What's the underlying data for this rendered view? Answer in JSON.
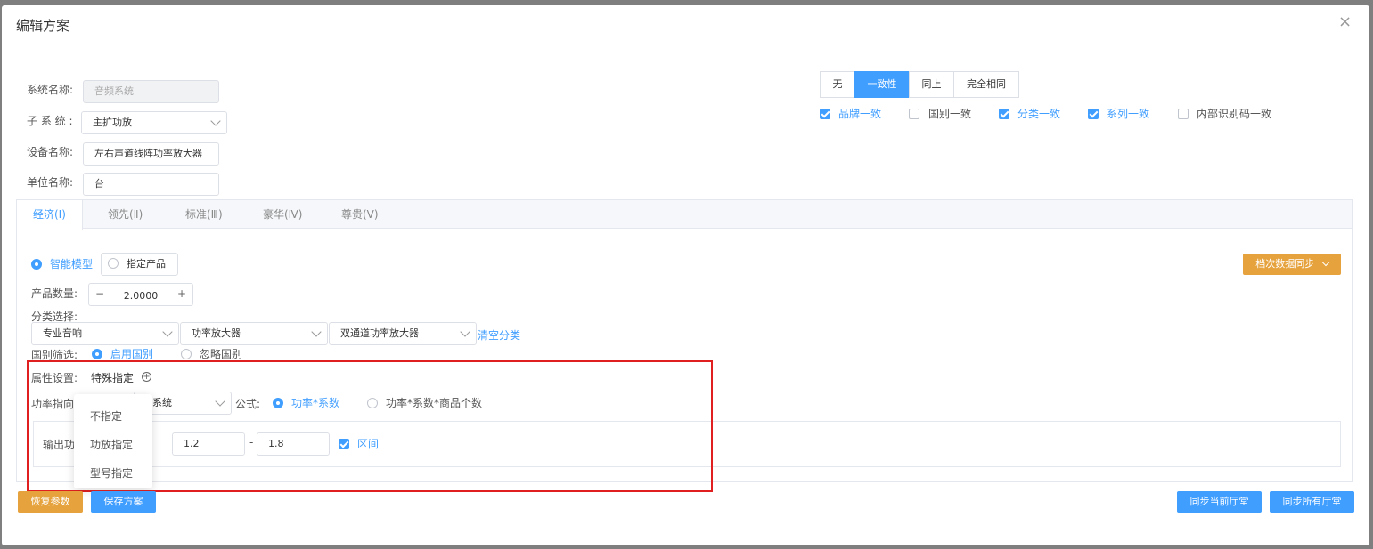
{
  "dialog": {
    "title": "编辑方案",
    "close_icon": "close-icon"
  },
  "form": {
    "system_name_label": "系统名称:",
    "system_name_value": "音频系统",
    "subsystem_label": "子 系 统 :",
    "subsystem_value": "主扩功放",
    "device_name_label": "设备名称:",
    "device_name_value": "左右声道线阵功率放大器",
    "unit_label": "单位名称:",
    "unit_value": "台"
  },
  "consistency": {
    "segments": [
      "无",
      "一致性",
      "同上",
      "完全相同"
    ],
    "active_segment": "一致性",
    "checks": [
      {
        "label": "品牌一致",
        "checked": true
      },
      {
        "label": "国别一致",
        "checked": false
      },
      {
        "label": "分类一致",
        "checked": true
      },
      {
        "label": "系列一致",
        "checked": true
      },
      {
        "label": "内部识别码一致",
        "checked": false
      }
    ]
  },
  "tabs": [
    "经济(Ⅰ)",
    "领先(Ⅱ)",
    "标准(Ⅲ)",
    "豪华(Ⅳ)",
    "尊贵(Ⅴ)"
  ],
  "panel": {
    "mode_smart": "智能模型",
    "mode_specified": "指定产品",
    "sync_button": "档次数据同步",
    "quantity_label": "产品数量:",
    "quantity_value": "2.0000",
    "minus": "−",
    "plus": "+",
    "category_label": "分类选择:",
    "category_1": "专业音响",
    "category_2": "功率放大器",
    "category_3": "双通道功率放大器",
    "clear_category": "清空分类",
    "country_label": "国别筛选:",
    "country_enable": "启用国别",
    "country_ignore": "忽略国别",
    "attr_label": "属性设置:",
    "attr_special": "特殊指定",
    "power_label": "功率指向",
    "power_select_value": "系统",
    "formula_label": "公式:",
    "formula_1": "功率*系数",
    "formula_2": "功率*系数*商品个数",
    "output_label": "输出功",
    "range_from": "1.2",
    "range_sep": "-",
    "range_to": "1.8",
    "range_checkbox": "区间"
  },
  "dropdown": {
    "items": [
      "不指定",
      "功放指定",
      "型号指定"
    ]
  },
  "footer": {
    "restore": "恢复参数",
    "save": "保存方案",
    "sync_current": "同步当前厅堂",
    "sync_all": "同步所有厅堂"
  },
  "colors": {
    "primary": "#409eff",
    "warning": "#e6a23c",
    "highlight_box": "#e02020"
  }
}
